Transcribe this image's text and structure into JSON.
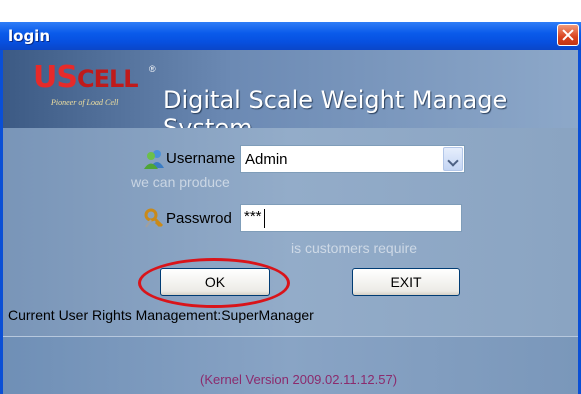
{
  "window": {
    "title": "login"
  },
  "banner": {
    "logo_us": "US",
    "logo_cell": "CELL",
    "logo_tagline": "Pioneer of Load Cell",
    "app_title": "Digital Scale Weight Manage System"
  },
  "watermark": {
    "line1": "we can produce",
    "line2": "is customers require"
  },
  "form": {
    "username_label": "Username",
    "username_value": "Admin",
    "password_label": "Passwrod",
    "password_value": "***"
  },
  "buttons": {
    "ok": "OK",
    "exit": "EXIT"
  },
  "status": {
    "rights": "Current User Rights Management:SuperManager"
  },
  "footer": {
    "version": "(Kernel Version 2009.02.11.12.57)"
  },
  "colors": {
    "titlebar": "#0a5bea",
    "highlight_circle": "#d9141a",
    "version_text": "#8b2b6d"
  }
}
